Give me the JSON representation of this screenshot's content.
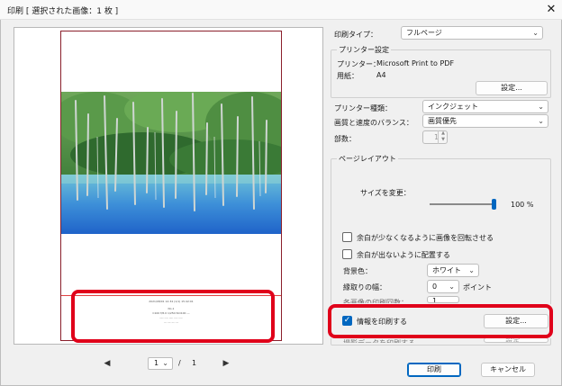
{
  "window": {
    "title": "印刷 [ 選択された画像：1 枚 ]",
    "close": "✕"
  },
  "preview": {
    "info_lines": [
      "2021/08/01 12:34 (1/1) 15:42:01",
      "No.1",
      "C100 f/8.0 1/250 ISO100 ---",
      "---- ---- ---- ---- ----",
      "--- --- --- ---"
    ],
    "nav": {
      "prev": "◀",
      "next": "▶",
      "page": "1",
      "separator": "/",
      "total": "1"
    }
  },
  "print_type": {
    "label": "印刷タイプ：",
    "value": "フルページ"
  },
  "printer_settings": {
    "title": "プリンター設定",
    "printer_label": "プリンター：",
    "printer_value": "Microsoft Print to PDF",
    "paper_label": "用紙：",
    "paper_value": "A4",
    "settings_button": "設定..."
  },
  "printer_kind": {
    "label": "プリンター種類：",
    "value": "インクジェット"
  },
  "quality_balance": {
    "label": "画質と速度のバランス：",
    "value": "画質優先"
  },
  "copies": {
    "label": "部数：",
    "value": "1"
  },
  "page_layout": {
    "title": "ページレイアウト",
    "resize_label": "サイズを変更：",
    "resize_value": "100 %",
    "resize_fraction": 1.0,
    "rotate_checkbox": "余白が少なくなるように画像を回転させる",
    "nomargin_checkbox": "余白が出ないように配置する",
    "bg_label": "背景色：",
    "bg_value": "ホワイト",
    "border_label": "縁取りの幅：",
    "border_value": "0",
    "border_unit": "ポイント",
    "count_label": "各画像の印刷回数：",
    "count_value": "1"
  },
  "print_info": {
    "checkbox_label": "情報を印刷する",
    "checked": true,
    "settings_button": "設定..."
  },
  "hidden_row": {
    "checkbox_label": "撮影データを印刷する",
    "settings_button": "設定..."
  },
  "footer": {
    "print_button": "印刷",
    "cancel_button": "キャンセル"
  },
  "colors": {
    "accent": "#0067c0",
    "highlight": "#e0001a",
    "paper_border": "#8a1f2b"
  },
  "icons": [
    "close-icon",
    "chevron-down-icon",
    "check-icon",
    "arrow-left-icon",
    "arrow-right-icon",
    "spin-icon"
  ]
}
